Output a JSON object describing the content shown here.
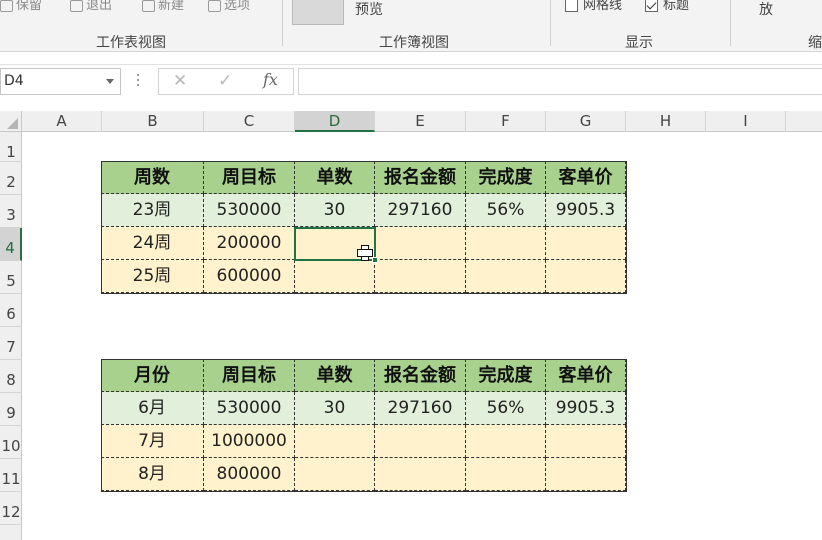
{
  "ribbon": {
    "view_buttons": [
      "保留",
      "退出",
      "新建",
      "选项"
    ],
    "preview_label": "预览",
    "gridlines_label": "网格线",
    "headings_label": "标题",
    "zoom_label": "放",
    "groups": [
      "工作表视图",
      "工作簿视图",
      "显示",
      "缩"
    ]
  },
  "formula_bar": {
    "name_box": "D4",
    "cancel_glyph": "✕",
    "enter_glyph": "✓",
    "fx_label": "fx",
    "formula": ""
  },
  "columns": [
    "A",
    "B",
    "C",
    "D",
    "E",
    "F",
    "G",
    "H",
    "I"
  ],
  "rows": [
    "1",
    "2",
    "3",
    "4",
    "5",
    "6",
    "7",
    "8",
    "9",
    "10",
    "11",
    "12"
  ],
  "active_cell": "D4",
  "table1": {
    "headers": [
      "周数",
      "周目标",
      "单数",
      "报名金额",
      "完成度",
      "客单价"
    ],
    "rows": [
      [
        "23周",
        "530000",
        "30",
        "297160",
        "56%",
        "9905.3"
      ],
      [
        "24周",
        "200000",
        "",
        "",
        "",
        ""
      ],
      [
        "25周",
        "600000",
        "",
        "",
        "",
        ""
      ]
    ]
  },
  "table2": {
    "headers": [
      "月份",
      "周目标",
      "单数",
      "报名金额",
      "完成度",
      "客单价"
    ],
    "rows": [
      [
        "6月",
        "530000",
        "30",
        "297160",
        "56%",
        "9905.3"
      ],
      [
        "7月",
        "1000000",
        "",
        "",
        "",
        ""
      ],
      [
        "8月",
        "800000",
        "",
        "",
        "",
        ""
      ]
    ]
  },
  "colors": {
    "header_fill": "#a9d18e",
    "first_row_fill": "#e2efda",
    "empty_row_fill": "#fff2cc",
    "selection": "#217346"
  }
}
